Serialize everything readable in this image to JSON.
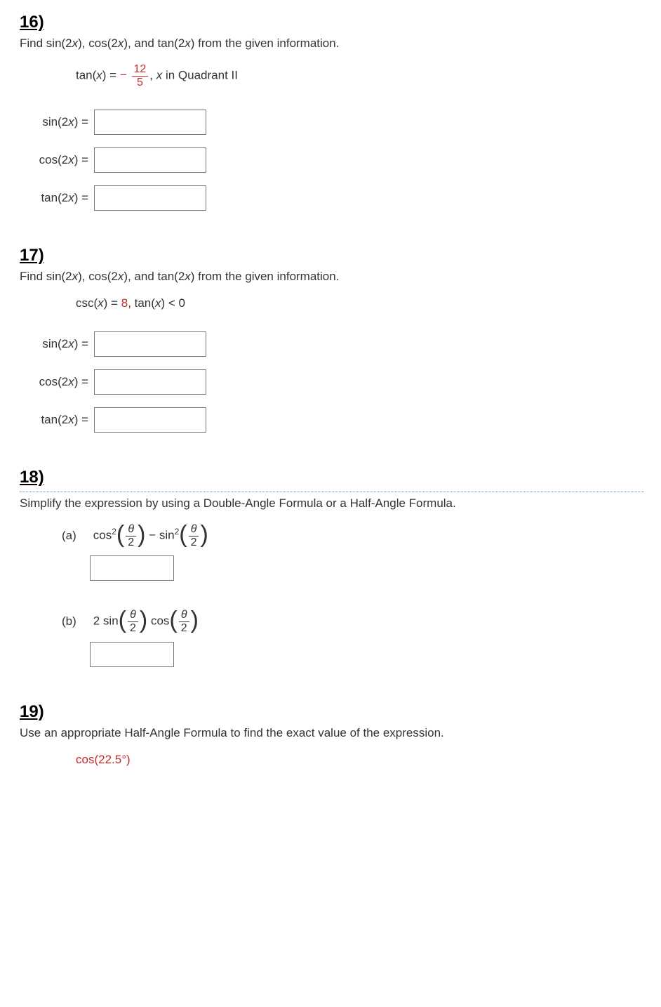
{
  "problems": {
    "p16": {
      "number": "16)",
      "prompt_prefix": "Find sin(2",
      "prompt_mid1": "), cos(2",
      "prompt_mid2": "), and tan(2",
      "prompt_suffix": ") from the given information.",
      "given_prefix": "tan(",
      "given_eq": ") = ",
      "given_minus": "− ",
      "given_frac_num": "12",
      "given_frac_den": "5",
      "given_comma": ",   ",
      "given_suffix": " in Quadrant II",
      "rows": {
        "sin_label_a": "sin(2",
        "sin_label_b": ")  =",
        "cos_label_a": "cos(2",
        "cos_label_b": ") =",
        "tan_label_a": "tan(2",
        "tan_label_b": ") ="
      }
    },
    "p17": {
      "number": "17)",
      "prompt_prefix": "Find sin(2",
      "prompt_mid1": "), cos(2",
      "prompt_mid2": "), and tan(2",
      "prompt_suffix": ") from the given information.",
      "given_csc_a": "csc(",
      "given_csc_b": ") = ",
      "given_csc_val": "8",
      "given_sep": ",   tan(",
      "given_tan_b": ") < 0",
      "rows": {
        "sin_label_a": "sin(2",
        "sin_label_b": ")  =",
        "cos_label_a": "cos(2",
        "cos_label_b": ")  =",
        "tan_label_a": "tan(2",
        "tan_label_b": ")  ="
      }
    },
    "p18": {
      "number": "18)",
      "prompt": "Simplify the expression by using a Double-Angle Formula or a Half-Angle Formula.",
      "a_label": "(a)",
      "a_cos": "cos",
      "a_sq": "2",
      "a_minus": " − sin",
      "a_theta": "θ",
      "a_two": "2",
      "b_label": "(b)",
      "b_two": "2 sin",
      "b_cos": " cos",
      "b_theta": "θ",
      "b_den": "2"
    },
    "p19": {
      "number": "19)",
      "prompt": "Use an appropriate Half-Angle Formula to find the exact value of the expression.",
      "expr": "cos(22.5°)"
    }
  },
  "shared": {
    "x": "x"
  }
}
